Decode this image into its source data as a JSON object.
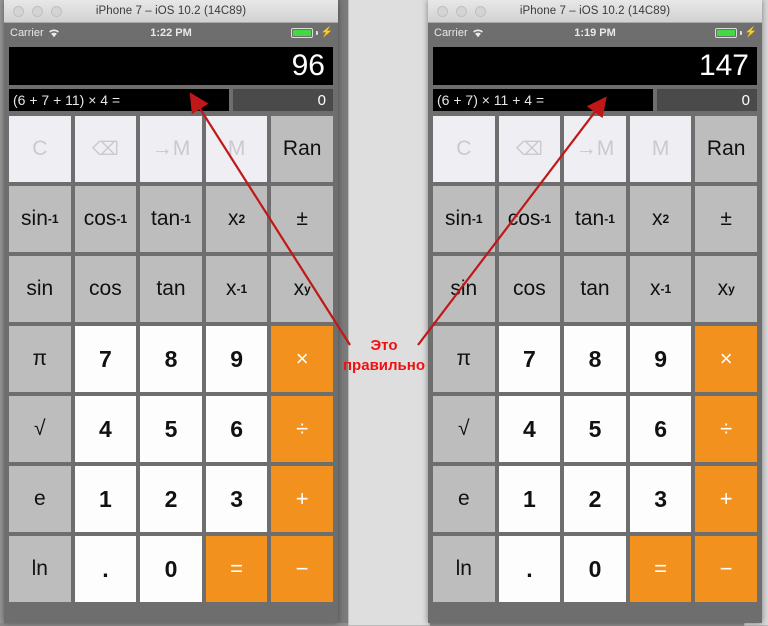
{
  "desktop": {
    "background_color": "#9a9a9a",
    "panel_color": "#dedede"
  },
  "annotation": {
    "line1": "Это",
    "line2": "правильно",
    "color": "#ee1111",
    "arrow_color": "#c01818"
  },
  "windows": [
    {
      "title": "iPhone 7 – iOS 10.2 (14C89)",
      "status": {
        "carrier": "Carrier",
        "wifi_icon": "wifi-icon",
        "time": "1:22 PM",
        "battery_icon": "battery-full-icon",
        "charging_icon": "lightning-bolt-icon"
      },
      "display": {
        "result": "96",
        "expression": "(6 + 7 + 11) × 4 =",
        "memory": "0"
      }
    },
    {
      "title": "iPhone 7 – iOS 10.2 (14C89)",
      "status": {
        "carrier": "Carrier",
        "wifi_icon": "wifi-icon",
        "time": "1:19 PM",
        "battery_icon": "battery-full-icon",
        "charging_icon": "lightning-bolt-icon"
      },
      "display": {
        "result": "147",
        "expression": "(6 + 7) × 11 + 4 =",
        "memory": "0"
      }
    }
  ],
  "keypad": {
    "rows": [
      [
        {
          "name": "clear",
          "label": "C",
          "style": "dim"
        },
        {
          "name": "backspace",
          "label": "⌫",
          "style": "dim"
        },
        {
          "name": "store-memory",
          "label": "→M",
          "style": "dim"
        },
        {
          "name": "recall-memory",
          "label": "M",
          "style": "dim"
        },
        {
          "name": "random",
          "label": "Ran",
          "style": "fn"
        }
      ],
      [
        {
          "name": "asin",
          "label": "sin",
          "sup": "-1",
          "style": "fn"
        },
        {
          "name": "acos",
          "label": "cos",
          "sup": "-1",
          "style": "fn"
        },
        {
          "name": "atan",
          "label": "tan",
          "sup": "-1",
          "style": "fn"
        },
        {
          "name": "square",
          "label": "x",
          "sup": "2",
          "style": "fn"
        },
        {
          "name": "plus-minus",
          "label": "±",
          "style": "fn"
        }
      ],
      [
        {
          "name": "sin",
          "label": "sin",
          "style": "fn"
        },
        {
          "name": "cos",
          "label": "cos",
          "style": "fn"
        },
        {
          "name": "tan",
          "label": "tan",
          "style": "fn"
        },
        {
          "name": "reciprocal",
          "label": "x",
          "sup": "-1",
          "style": "fn"
        },
        {
          "name": "power",
          "label": "x",
          "sup": "y",
          "style": "fn"
        }
      ],
      [
        {
          "name": "pi",
          "label": "π",
          "style": "fn"
        },
        {
          "name": "digit-7",
          "label": "7",
          "style": "num"
        },
        {
          "name": "digit-8",
          "label": "8",
          "style": "num"
        },
        {
          "name": "digit-9",
          "label": "9",
          "style": "num"
        },
        {
          "name": "multiply",
          "label": "×",
          "style": "op"
        }
      ],
      [
        {
          "name": "sqrt",
          "label": "√",
          "style": "fn"
        },
        {
          "name": "digit-4",
          "label": "4",
          "style": "num"
        },
        {
          "name": "digit-5",
          "label": "5",
          "style": "num"
        },
        {
          "name": "digit-6",
          "label": "6",
          "style": "num"
        },
        {
          "name": "divide",
          "label": "÷",
          "style": "op"
        }
      ],
      [
        {
          "name": "euler",
          "label": "e",
          "style": "fn"
        },
        {
          "name": "digit-1",
          "label": "1",
          "style": "num"
        },
        {
          "name": "digit-2",
          "label": "2",
          "style": "num"
        },
        {
          "name": "digit-3",
          "label": "3",
          "style": "num"
        },
        {
          "name": "plus",
          "label": "+",
          "style": "op"
        }
      ],
      [
        {
          "name": "ln",
          "label": "ln",
          "style": "fn"
        },
        {
          "name": "decimal-point",
          "label": ".",
          "style": "num"
        },
        {
          "name": "digit-0",
          "label": "0",
          "style": "num"
        },
        {
          "name": "equals",
          "label": "=",
          "style": "op"
        },
        {
          "name": "minus",
          "label": "−",
          "style": "op"
        }
      ]
    ]
  }
}
